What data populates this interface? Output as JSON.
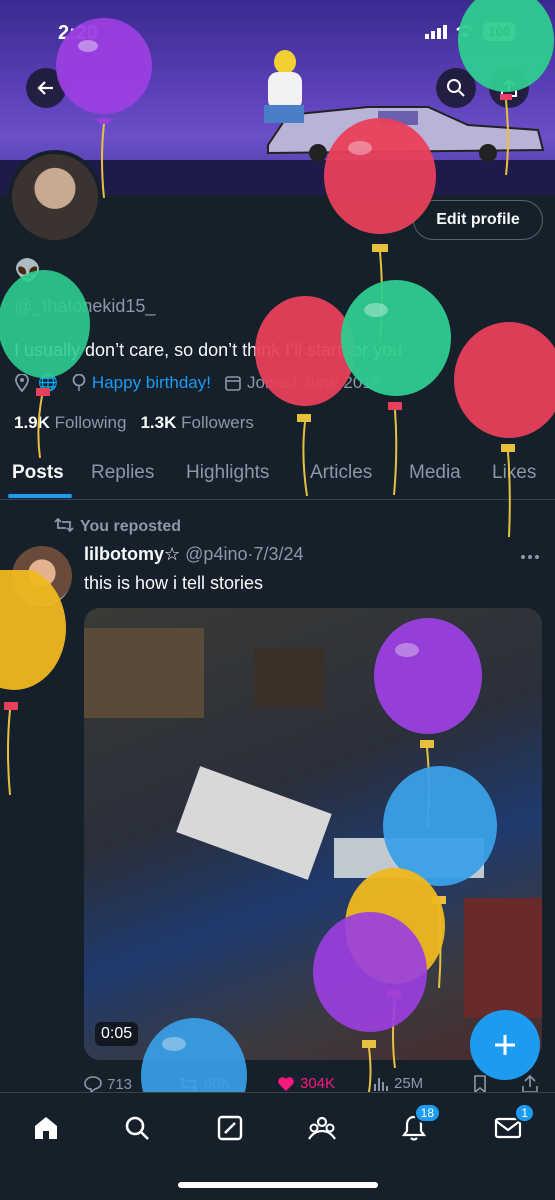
{
  "status_bar": {
    "time": "2:20",
    "battery": "100"
  },
  "profile": {
    "name_emoji": "👽",
    "handle": "@_thatonekid15_",
    "bio": "I usually don’t care, so don’t think I’ll start for you",
    "birthday": "Happy birthday!",
    "joined": "Joined June 2015",
    "following_count": "1.9K",
    "following_label": "Following",
    "followers_count": "1.3K",
    "followers_label": "Followers",
    "edit_profile_label": "Edit profile"
  },
  "tabs": [
    {
      "label": "Posts",
      "active": true
    },
    {
      "label": "Replies"
    },
    {
      "label": "Highlights"
    },
    {
      "label": "Articles"
    },
    {
      "label": "Media"
    },
    {
      "label": "Likes"
    }
  ],
  "post": {
    "repost_label": "You reposted",
    "author_name": "lilbotomy☆",
    "author_handle": "@p4ino",
    "date": "7/3/24",
    "text": "this is how i tell stories",
    "video_duration": "0:05",
    "replies": "713",
    "reposts": "60K",
    "likes": "304K",
    "views": "25M"
  },
  "bottom_nav": {
    "notifications_badge": "18",
    "messages_badge": "1"
  },
  "colors": {
    "background": "#15202b",
    "accent": "#1d9bf0",
    "like": "#f91880",
    "muted": "#8b98a5"
  },
  "icons": [
    "back-arrow-icon",
    "search-icon",
    "share-icon",
    "location-icon",
    "balloon-icon",
    "calendar-icon",
    "repost-icon",
    "more-icon",
    "reply-icon",
    "heart-icon",
    "views-icon",
    "bookmark-icon",
    "plus-icon",
    "home-icon",
    "compose-icon",
    "communities-icon",
    "bell-icon",
    "mail-icon"
  ]
}
